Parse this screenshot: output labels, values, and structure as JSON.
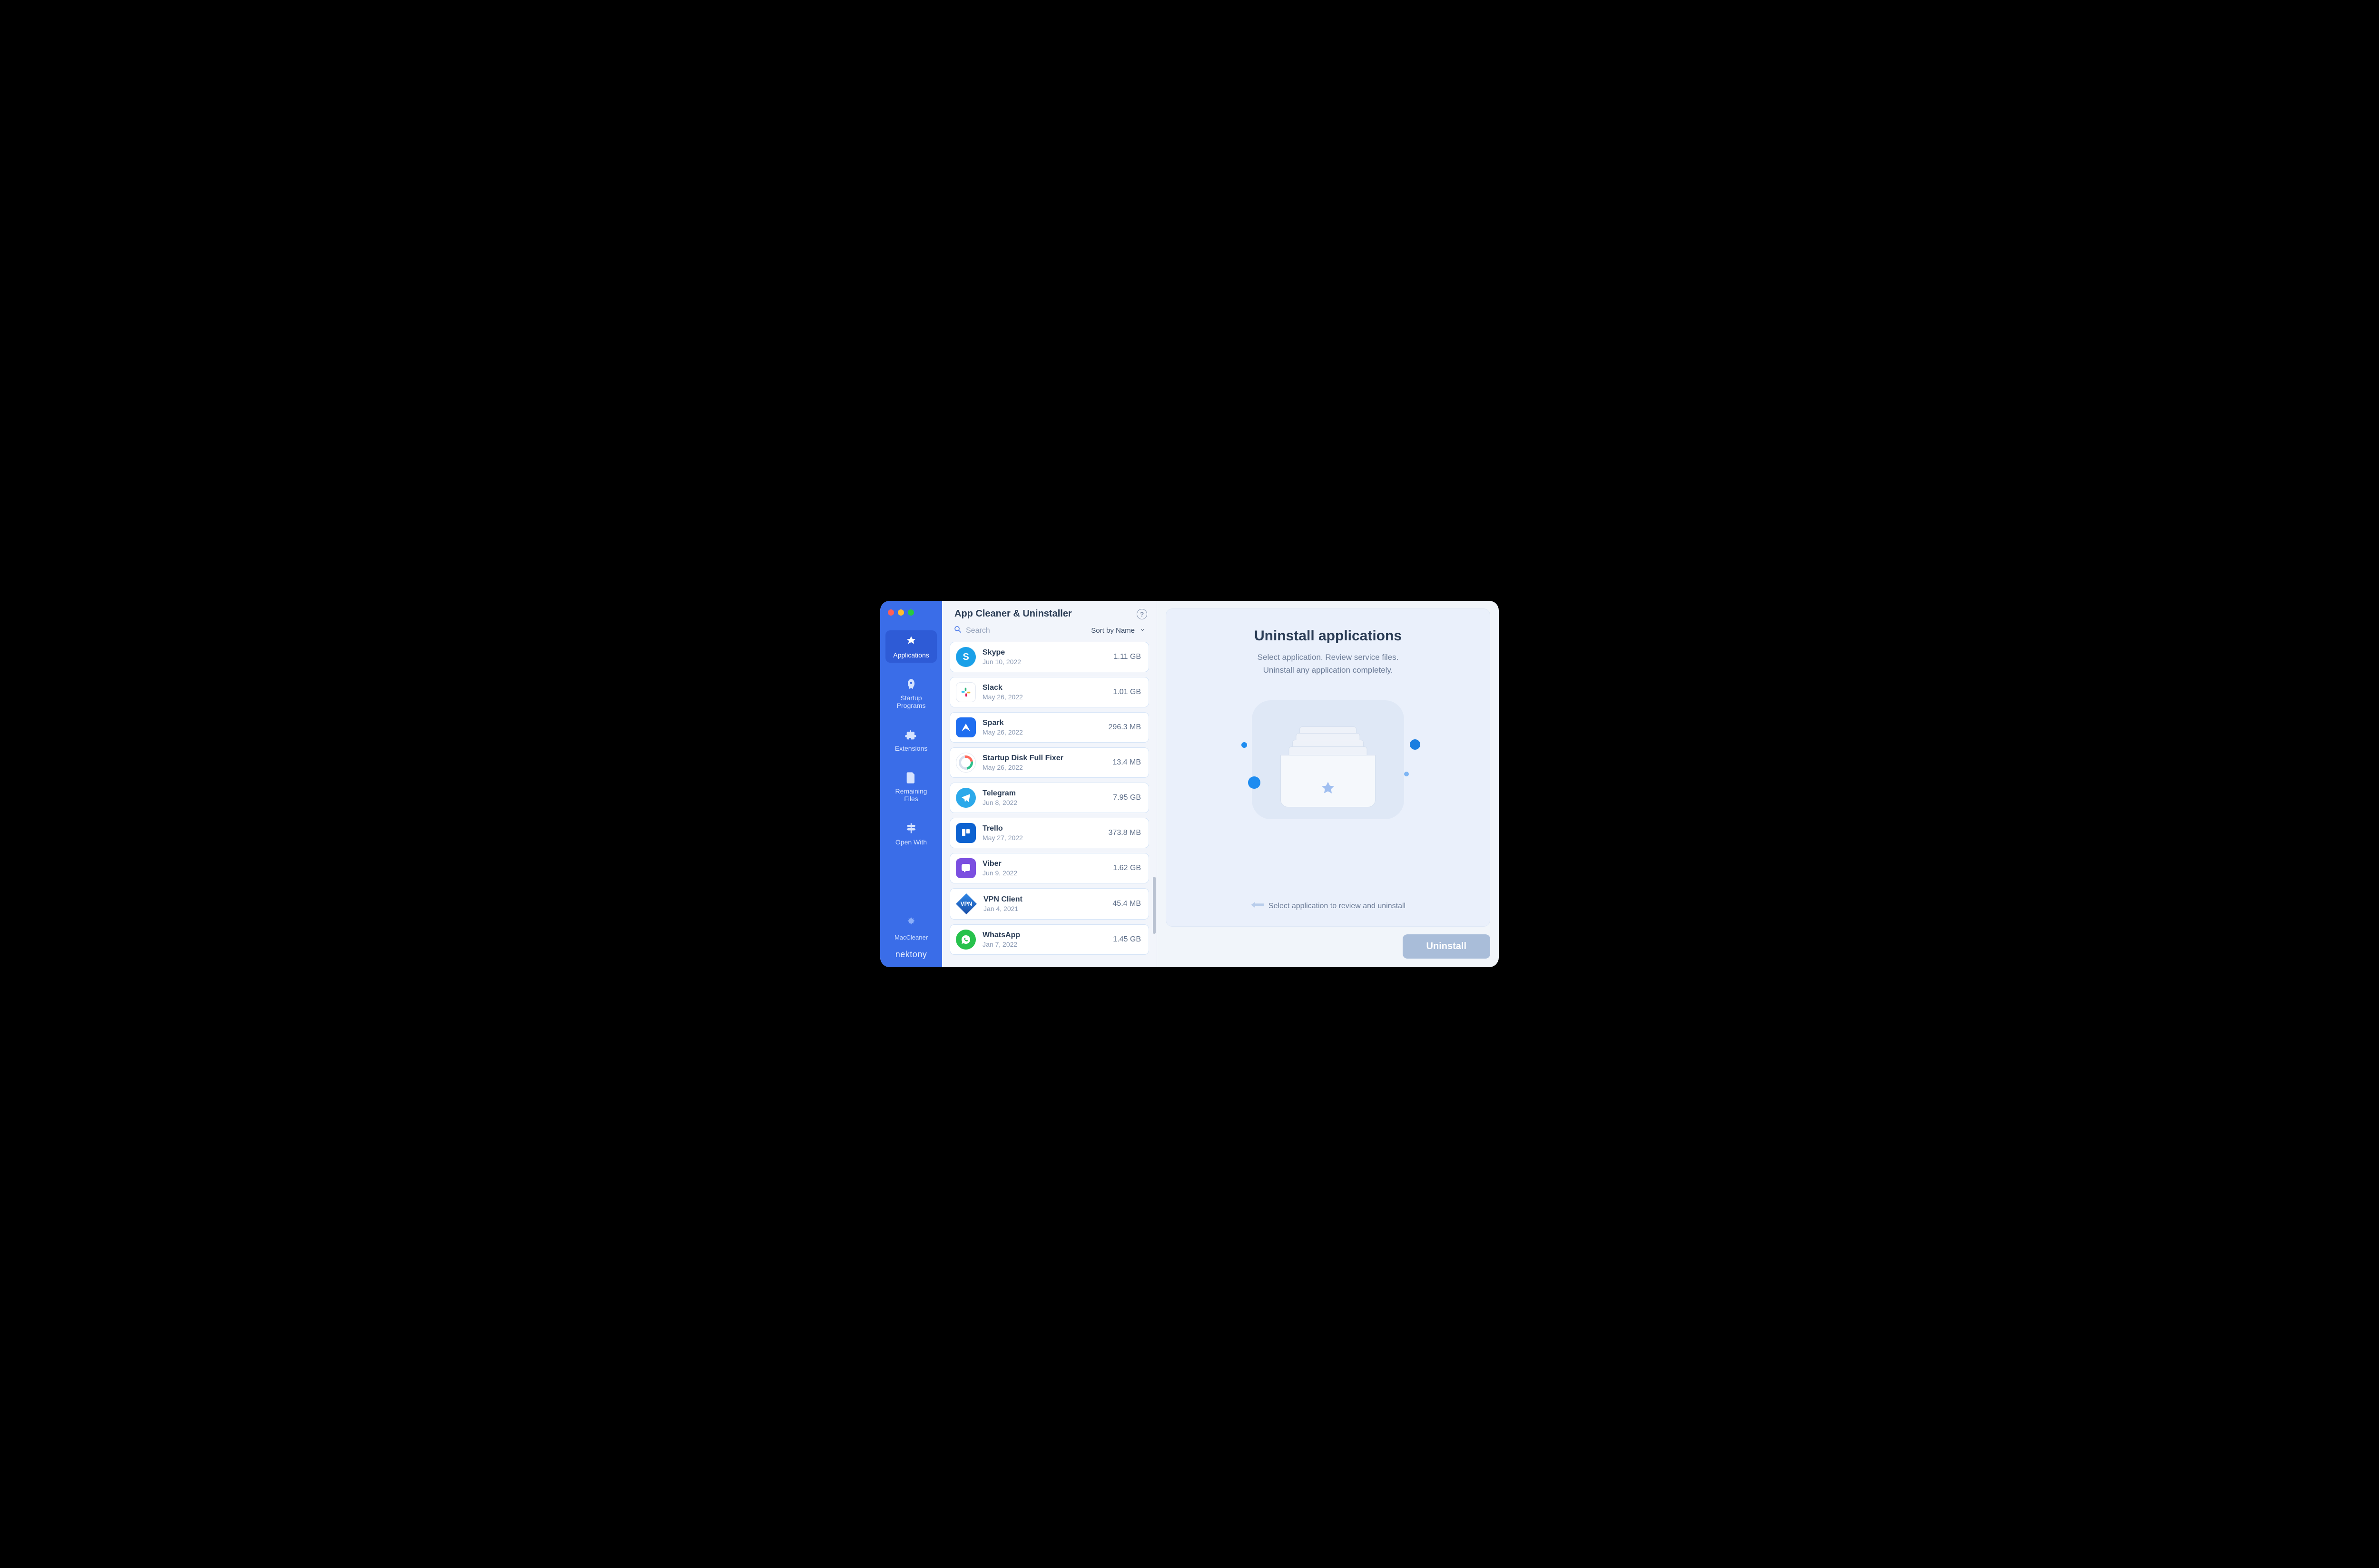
{
  "window": {
    "title": "App Cleaner & Uninstaller"
  },
  "sidebar": {
    "items": [
      {
        "label": "Applications"
      },
      {
        "label": "Startup\nPrograms"
      },
      {
        "label": "Extensions"
      },
      {
        "label": "Remaining\nFiles"
      },
      {
        "label": "Open With"
      }
    ],
    "maccleaner_label": "MacCleaner",
    "brand": "nektony"
  },
  "middle": {
    "search_placeholder": "Search",
    "sort_label": "Sort by Name",
    "apps": [
      {
        "name": "Skype",
        "date": "Jun 10, 2022",
        "size": "1.11 GB"
      },
      {
        "name": "Slack",
        "date": "May 26, 2022",
        "size": "1.01 GB"
      },
      {
        "name": "Spark",
        "date": "May 26, 2022",
        "size": "296.3 MB"
      },
      {
        "name": "Startup Disk Full Fixer",
        "date": "May 26, 2022",
        "size": "13.4 MB"
      },
      {
        "name": "Telegram",
        "date": "Jun 8, 2022",
        "size": "7.95 GB"
      },
      {
        "name": "Trello",
        "date": "May 27, 2022",
        "size": "373.8 MB"
      },
      {
        "name": "Viber",
        "date": "Jun 9, 2022",
        "size": "1.62 GB"
      },
      {
        "name": "VPN Client",
        "date": "Jan 4, 2021",
        "size": "45.4 MB"
      },
      {
        "name": "WhatsApp",
        "date": "Jan 7, 2022",
        "size": "1.45 GB"
      }
    ]
  },
  "right": {
    "heading": "Uninstall applications",
    "subheading": "Select application. Review service files.\nUninstall any application completely.",
    "hint": "Select application to review and uninstall",
    "uninstall_label": "Uninstall"
  }
}
